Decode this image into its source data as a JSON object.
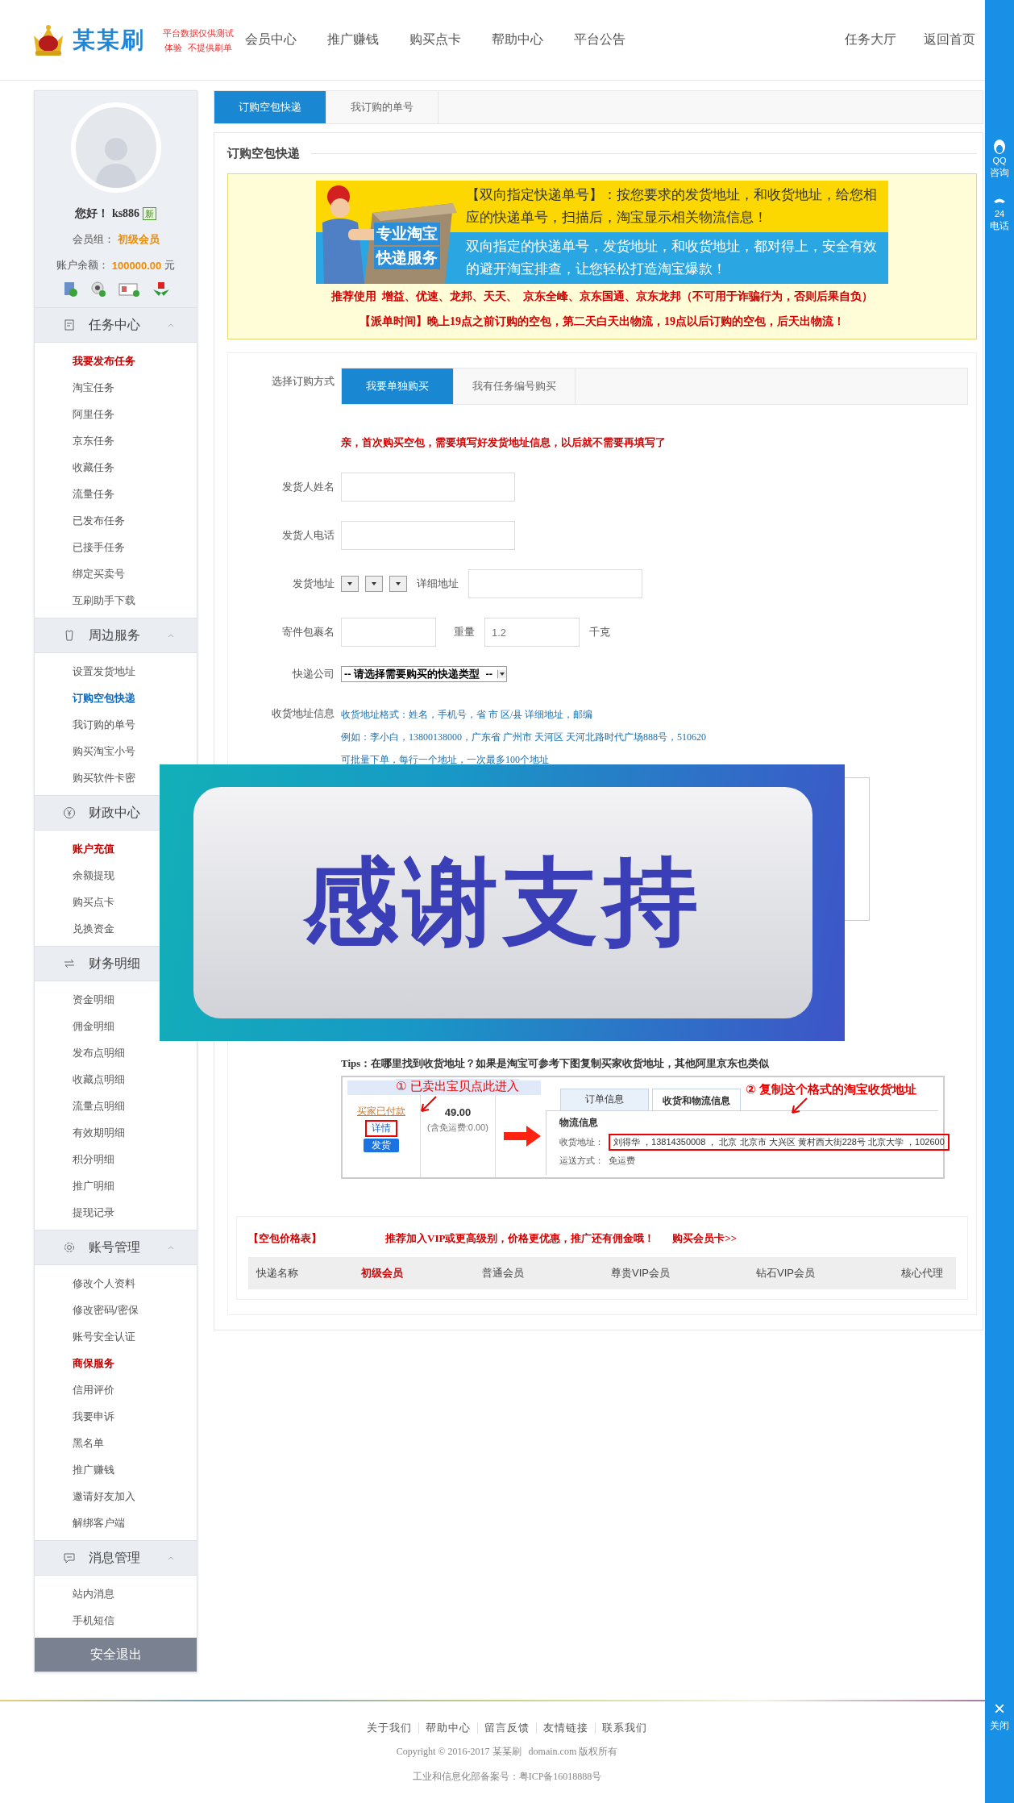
{
  "header": {
    "brand": "某某刷",
    "tagline": [
      "平台数据仅供测试",
      "体验  不提供刷单"
    ],
    "nav": [
      "会员中心",
      "推广赚钱",
      "购买点卡",
      "帮助中心",
      "平台公告"
    ],
    "right_links": [
      "任务大厅",
      "返回首页"
    ]
  },
  "side_toolbar": {
    "items": [
      {
        "kind": "qq",
        "badge": "QQ",
        "label": "咨询"
      },
      {
        "kind": "phone",
        "badge": "24",
        "label": "电话"
      }
    ],
    "close_symbol": "×",
    "close_label": "关闭"
  },
  "sidebar": {
    "profile": {
      "greeting": "您好！",
      "username": "ks886",
      "new_badge": "新",
      "group_label": "会员组：",
      "group": "初级会员",
      "balance_label": "账户余额：",
      "balance": "100000.00",
      "currency": "元"
    },
    "sections": [
      {
        "title": "任务中心",
        "expanded": true,
        "items": [
          {
            "label": "我要发布任务",
            "selected": false,
            "highlighted": true
          },
          {
            "label": "淘宝任务",
            "selected": false,
            "highlighted": false
          },
          {
            "label": "阿里任务",
            "selected": false,
            "highlighted": false
          },
          {
            "label": "京东任务",
            "selected": false,
            "highlighted": false
          },
          {
            "label": "收藏任务",
            "selected": false,
            "highlighted": false
          },
          {
            "label": "流量任务",
            "selected": false,
            "highlighted": false
          },
          {
            "label": "已发布任务",
            "selected": false,
            "highlighted": false
          },
          {
            "label": "已接手任务",
            "selected": false,
            "highlighted": false
          },
          {
            "label": "绑定买卖号",
            "selected": false,
            "highlighted": false
          },
          {
            "label": "互刷助手下载",
            "selected": false,
            "highlighted": false
          }
        ]
      },
      {
        "title": "周边服务",
        "expanded": true,
        "items": [
          {
            "label": "设置发货地址",
            "selected": false,
            "highlighted": false
          },
          {
            "label": "订购空包快递",
            "selected": true,
            "highlighted": false
          },
          {
            "label": "我订购的单号",
            "selected": false,
            "highlighted": false
          },
          {
            "label": "购买淘宝小号",
            "selected": false,
            "highlighted": false
          },
          {
            "label": "购买软件卡密",
            "selected": false,
            "highlighted": false
          }
        ]
      },
      {
        "title": "财政中心",
        "items": [
          {
            "label": "账户充值",
            "selected": false,
            "highlighted": true
          },
          {
            "label": "余额提现",
            "selected": false,
            "highlighted": false
          },
          {
            "label": "购买点卡",
            "selected": false,
            "highlighted": false
          },
          {
            "label": "兑换资金",
            "selected": false,
            "highlighted": false
          }
        ]
      },
      {
        "title": "财务明细",
        "items": [
          {
            "label": "资金明细",
            "selected": false,
            "highlighted": false
          },
          {
            "label": "佣金明细",
            "selected": false,
            "highlighted": false
          },
          {
            "label": "发布点明细",
            "selected": false,
            "highlighted": false
          },
          {
            "label": "收藏点明细",
            "selected": false,
            "highlighted": false
          },
          {
            "label": "流量点明细",
            "selected": false,
            "highlighted": false
          },
          {
            "label": "有效期明细",
            "selected": false,
            "highlighted": false
          },
          {
            "label": "积分明细",
            "selected": false,
            "highlighted": false
          },
          {
            "label": "推广明细",
            "selected": false,
            "highlighted": false
          },
          {
            "label": "提现记录",
            "selected": false,
            "highlighted": false
          }
        ]
      },
      {
        "title": "账号管理",
        "expanded": true,
        "items": [
          {
            "label": "修改个人资料",
            "selected": false,
            "highlighted": false
          },
          {
            "label": "修改密码/密保",
            "selected": false,
            "highlighted": false
          },
          {
            "label": "账号安全认证",
            "selected": false,
            "highlighted": false
          },
          {
            "label": "商保服务",
            "selected": false,
            "highlighted": true
          },
          {
            "label": "信用评价",
            "selected": false,
            "highlighted": false
          },
          {
            "label": "我要申诉",
            "selected": false,
            "highlighted": false
          },
          {
            "label": "黑名单",
            "selected": false,
            "highlighted": false
          },
          {
            "label": "推广赚钱",
            "selected": false,
            "highlighted": false
          },
          {
            "label": "邀请好友加入",
            "selected": false,
            "highlighted": false
          },
          {
            "label": "解绑客户端",
            "selected": false,
            "highlighted": false
          }
        ]
      },
      {
        "title": "消息管理",
        "expanded": true,
        "items": [
          {
            "label": "站内消息",
            "selected": false,
            "highlighted": false
          },
          {
            "label": "手机短信",
            "selected": false,
            "highlighted": false
          }
        ]
      }
    ],
    "logout": "安全退出"
  },
  "main_tabs": [
    {
      "label": "订购空包快递",
      "selected": true
    },
    {
      "label": "我订购的单号",
      "selected": false
    }
  ],
  "panel": {
    "title": "订购空包快递",
    "notice": {
      "banner": {
        "badge": [
          "专业淘宝",
          "快递服务"
        ],
        "headline": "【双向指定快递单号】：按您要求的发货地址，和收货地址，给您相应的快递单号，扫描后，淘宝显示相关物流信息！",
        "subline": "双向指定的快递单号，发货地址，和收货地址，都对得上，安全有效的避开淘宝排查，让您轻松打造淘宝爆款！"
      },
      "lines": [
        "推荐使用  增益、优速、龙邦、天天、  京东全峰、京东国通、京东龙邦（不可用于诈骗行为，否则后果自负）",
        "【派单时间】晚上19点之前订购的空包，第二天白天出物流，19点以后订购的空包，后天出物流！"
      ]
    },
    "order_form": {
      "method_label": "选择订购方式",
      "method_tabs": [
        {
          "label": "我要单独购买",
          "selected": true
        },
        {
          "label": "我有任务编号购买",
          "selected": false
        }
      ],
      "note": "亲，首次购买空包，需要填写好发货地址信息，以后就不需要再填写了",
      "fields": [
        {
          "kind": "text",
          "label": "发货人姓名"
        },
        {
          "kind": "text",
          "label": "发货人电话"
        },
        {
          "kind": "address",
          "label": "发货地址",
          "detail_label": "详细地址"
        },
        {
          "kind": "package",
          "label": "寄件包裹名",
          "weight_label": "重量",
          "weight_placeholder": "1.2",
          "unit": "千克"
        },
        {
          "kind": "select",
          "label": "快递公司",
          "value": "-- 请选择需要购买的快递类型  --"
        },
        {
          "kind": "textarea",
          "label": "收货地址信息",
          "hints": [
            "收货地址格式：姓名，手机号，省 市 区/县 详细地址，邮编",
            "例如：李小白，13800138000，广东省 广州市 天河区 天河北路时代广场888号，510620",
            "可批量下单，每行一个地址，一次最多100个地址"
          ]
        }
      ]
    },
    "tips": {
      "text": "Tips：在哪里找到收货地址？如果是淘宝可参考下图复制买家收货地址，其他阿里京东也类似",
      "screenshot": {
        "step1": "① 已卖出宝贝点此进入",
        "status": "买家已付款",
        "detail_button": "详情",
        "ship_button": "发货",
        "price": "49.00",
        "shipping_note": "(含免运费:0.00)",
        "tabs": [
          {
            "label": "订单信息",
            "selected": false
          },
          {
            "label": "收货和物流信息",
            "selected": true
          }
        ],
        "step2": "② 复制这个格式的淘宝收货地址",
        "section": "物流信息",
        "address_label": "收货地址：",
        "address": "刘得华 ，13814350008 ， 北京 北京市 大兴区 黄村西大街228号 北京大学 ，102600",
        "shipping_label": "运送方式：",
        "shipping": "免运费"
      }
    },
    "price_table": {
      "title": "【空包价格表】",
      "promo": "推荐加入VIP或更高级别，价格更优惠，推广还有佣金哦！",
      "link": "购买会员卡>>",
      "columns": [
        {
          "label": "快递名称",
          "current": false
        },
        {
          "label": "初级会员",
          "current": true
        },
        {
          "label": "普通会员",
          "current": false
        },
        {
          "label": "尊贵VIP会员",
          "current": false
        },
        {
          "label": "钻石VIP会员",
          "current": false
        },
        {
          "label": "核心代理",
          "current": false
        }
      ]
    }
  },
  "overlay": {
    "text": "感谢支持"
  },
  "footer": {
    "links": [
      "关于我们",
      "帮助中心",
      "留言反馈",
      "友情链接",
      "联系我们"
    ],
    "copyright": "Copyright © 2016-2017 某某刷   domain.com 版权所有",
    "icp": "工业和信息化部备案号：粤ICP备16018888号"
  }
}
